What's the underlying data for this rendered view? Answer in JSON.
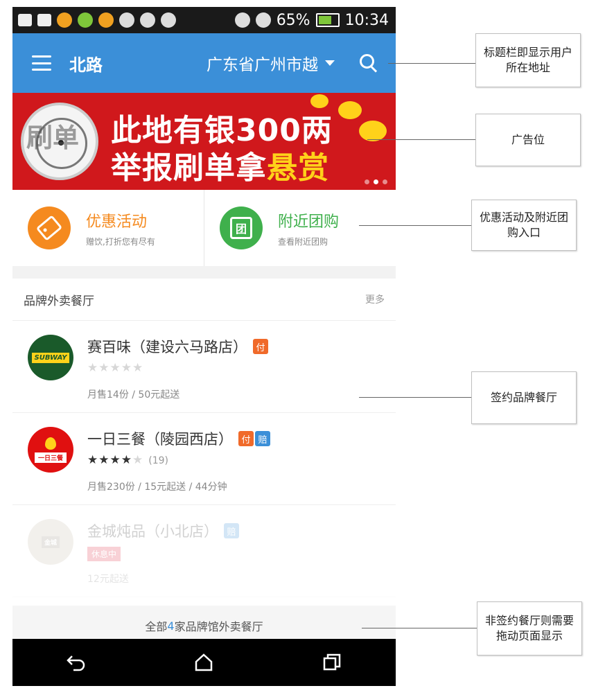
{
  "status_bar": {
    "battery": "65%",
    "time": "10:34"
  },
  "title_bar": {
    "title": "北路",
    "location": "广东省广州市越"
  },
  "banner": {
    "logo_text": "刷单",
    "line1": "此地有银300两",
    "line2_main": "举报刷单拿",
    "line2_highlight": "悬赏"
  },
  "entries": [
    {
      "title": "优惠活动",
      "subtitle": "赠饮,打折您有尽有"
    },
    {
      "title": "附近团购",
      "subtitle": "查看附近团购"
    }
  ],
  "brand_list": {
    "title": "品牌外卖餐厅",
    "more": "更多",
    "shops": [
      {
        "name": "赛百味（建设六马路店）",
        "logo_text": "SUBWAY",
        "badges": [
          "付"
        ],
        "stars": 0,
        "rating_count": "",
        "meta": "月售14份 / 50元起送"
      },
      {
        "name": "一日三餐（陵园西店）",
        "logo_text": "一日三餐",
        "badges": [
          "付",
          "赔"
        ],
        "stars": 4,
        "rating_count": "(19)",
        "meta": "月售230份 / 15元起送 / 44分钟"
      },
      {
        "name": "金城炖品（小北店）",
        "logo_text": "金城",
        "badges": [
          "赔"
        ],
        "tag": "休息中",
        "meta": "12元起送"
      }
    ],
    "footer_prefix": "全部",
    "footer_count": "4",
    "footer_suffix": "家品牌馆外卖餐厅"
  },
  "annotations": {
    "title_bar": "标题栏即显示用户所在地址",
    "ad_slot": "广告位",
    "entries": "优惠活动及附近团购入口",
    "brand": "签约品牌餐厅",
    "non_signed": "非签约餐厅则需要拖动页面显示"
  },
  "colors": {
    "title_bar": "#3b8fd8",
    "banner": "#d0181c",
    "orange": "#f58a1f",
    "green": "#3fb04c",
    "accent": "#3b8fd8"
  }
}
